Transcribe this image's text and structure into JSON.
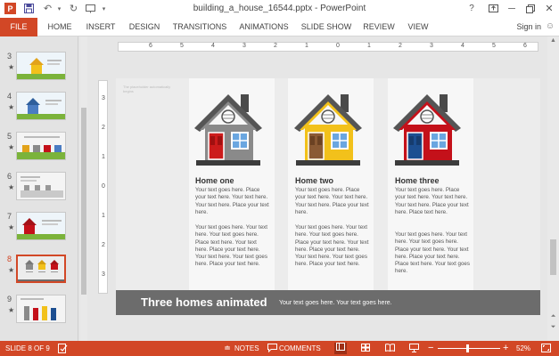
{
  "titlebar": {
    "title": "building_a_house_16544.pptx - PowerPoint",
    "qa_icons": [
      "powerpoint-logo",
      "save",
      "undo",
      "undo-dropdown",
      "redo",
      "start-from-beginning"
    ],
    "help_glyph": "?",
    "minimize_glyph": "─",
    "close_glyph": "✕"
  },
  "ribbon": {
    "tabs": [
      "FILE",
      "HOME",
      "INSERT",
      "DESIGN",
      "TRANSITIONS",
      "ANIMATIONS",
      "SLIDE SHOW",
      "REVIEW",
      "VIEW"
    ],
    "signin": "Sign in",
    "accent": "#d24726"
  },
  "thumbnails": [
    {
      "num": "3",
      "star": "★",
      "active": false
    },
    {
      "num": "4",
      "star": "★",
      "active": false
    },
    {
      "num": "5",
      "star": "★",
      "active": false
    },
    {
      "num": "6",
      "star": "★",
      "active": false
    },
    {
      "num": "7",
      "star": "★",
      "active": false
    },
    {
      "num": "8",
      "star": "★",
      "active": true
    },
    {
      "num": "9",
      "star": "★",
      "active": false
    }
  ],
  "ruler": {
    "horizontal": [
      "6",
      "5",
      "4",
      "3",
      "2",
      "1",
      "0",
      "1",
      "2",
      "3",
      "4",
      "5",
      "6"
    ],
    "vertical": [
      "3",
      "2",
      "1",
      "0",
      "1",
      "2",
      "3"
    ]
  },
  "slide": {
    "corner_note": "The placeholder automatically begins",
    "homes": [
      {
        "title": "Home one",
        "body_color": "#8a8a8a",
        "door_color": "#cc1b1b",
        "para1": "Your text goes here. Place your text here. Your text here. Your text here. Place your text here.",
        "para2": "Your text goes here. Your text here. Your text goes here. Place text here. Your text here. Place your text here. Your text here. Your text goes here. Place your text here."
      },
      {
        "title": "Home two",
        "body_color": "#f2c11b",
        "door_color": "#8a5a34",
        "para1": "Your text goes here. Place your text here. Your text here. Your text here. Place your text here.",
        "para2": "Your text goes here. Your text here. Your text goes here. Place your text here. Your text here. Place your text here. Your text here. Your text goes here. Place your text here."
      },
      {
        "title": "Home three",
        "body_color": "#c4111a",
        "door_color": "#1d4f91",
        "para1": "Your text goes here. Place your text here. Your text here. Your text here. Place your text here. Place text here.",
        "para2": "Your text goes here. Your text here. Your text goes here. Place your text here. Your text here. Place your text here. Place text here. Your text goes here."
      }
    ],
    "band_title": "Three homes animated",
    "band_sub": "Your text goes here. Your text goes here."
  },
  "statusbar": {
    "slide_info": "SLIDE 8 OF 9",
    "notes": "NOTES",
    "comments": "COMMENTS",
    "zoom": "52%",
    "zoom_minus": "−",
    "zoom_plus": "+",
    "zoom_level": 0.52
  }
}
